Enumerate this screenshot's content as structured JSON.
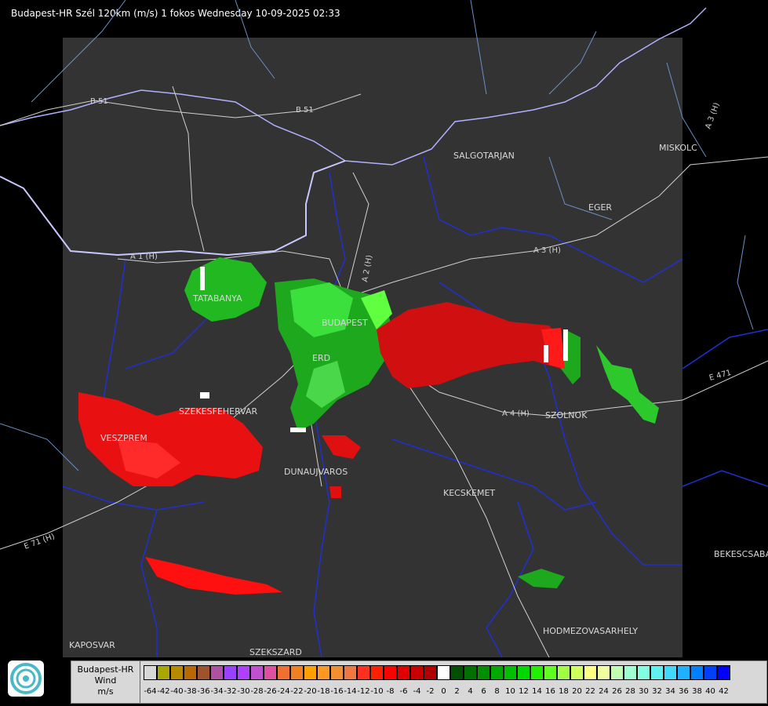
{
  "title": "Budapest-HR Szél 120km (m/s) 1 fokos Wednesday 10-09-2025 02:33",
  "cities": [
    {
      "name": "SALGOTARJAN"
    },
    {
      "name": "MISKOLC"
    },
    {
      "name": "EGER"
    },
    {
      "name": "TATABANYA"
    },
    {
      "name": "BUDAPEST"
    },
    {
      "name": "ERD"
    },
    {
      "name": "SZEKESFEHERVAR"
    },
    {
      "name": "VESZPREM"
    },
    {
      "name": "DUNAUJVAROS"
    },
    {
      "name": "SZOLNOK"
    },
    {
      "name": "KECSKEMET"
    },
    {
      "name": "BEKESCSABA"
    },
    {
      "name": "HODMEZOVASARHELY"
    },
    {
      "name": "KAPOSVAR"
    },
    {
      "name": "SZEKSZARD"
    }
  ],
  "roads": [
    "B 51",
    "B 51",
    "A 1 (H)",
    "A 2 (H)",
    "A 3 (H)",
    "A 3 (H)",
    "A 4 (H)",
    "E 471",
    "E 71 (H)"
  ],
  "legend": {
    "radar": "Budapest-HR",
    "quantity": "Wind",
    "unit": "m/s",
    "values": [
      "-64",
      "-42",
      "-40",
      "-38",
      "-36",
      "-34",
      "-32",
      "-30",
      "-28",
      "-26",
      "-24",
      "-22",
      "-20",
      "-18",
      "-16",
      "-14",
      "-12",
      "-10",
      "-8",
      "-6",
      "-4",
      "-2",
      "0",
      "2",
      "4",
      "6",
      "8",
      "10",
      "12",
      "14",
      "16",
      "18",
      "20",
      "22",
      "24",
      "26",
      "28",
      "30",
      "32",
      "34",
      "36",
      "38",
      "40",
      "42"
    ],
    "colors": [
      "#d8d8d8",
      "#a8a800",
      "#b88a00",
      "#b86a00",
      "#a0522d",
      "#b050a0",
      "#9a40ff",
      "#b040ff",
      "#c050d0",
      "#e050a0",
      "#f07030",
      "#f08020",
      "#ffa000",
      "#ff9820",
      "#f09030",
      "#f07840",
      "#ff3020",
      "#ff2000",
      "#ff0000",
      "#e00000",
      "#c80000",
      "#b00000",
      "#ffffff",
      "#005000",
      "#007000",
      "#009000",
      "#00a800",
      "#00c000",
      "#00d800",
      "#20f000",
      "#60ff20",
      "#a0ff40",
      "#d0ff60",
      "#ffff80",
      "#f0ffa0",
      "#c0ffb0",
      "#a0ffd0",
      "#80ffe0",
      "#60f0f0",
      "#40d8ff",
      "#20b0ff",
      "#0080ff",
      "#0040ff",
      "#0000ff"
    ]
  }
}
